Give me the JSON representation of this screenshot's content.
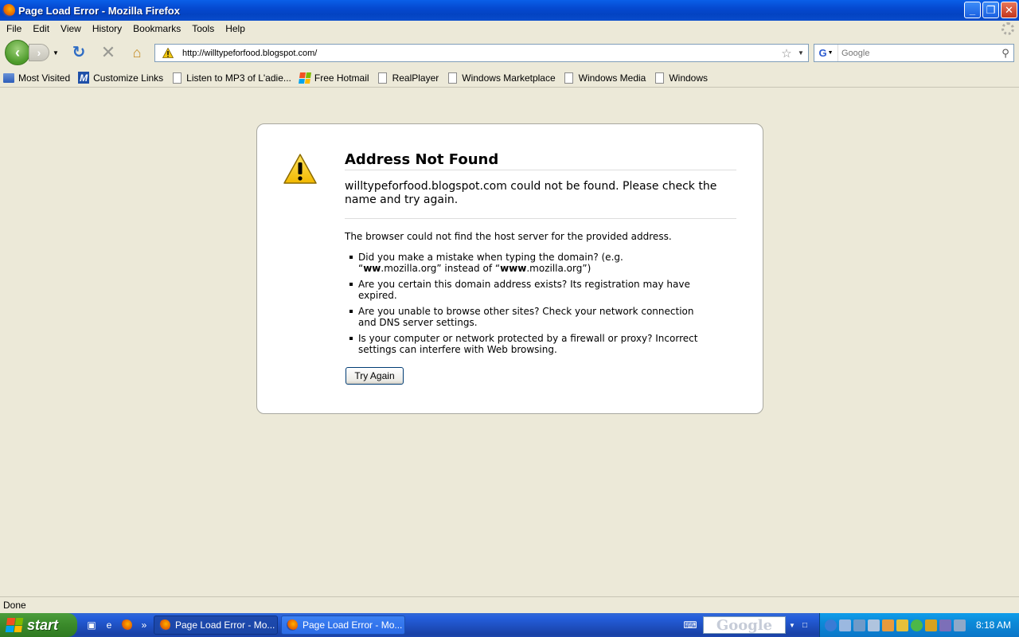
{
  "window": {
    "title": "Page Load Error - Mozilla Firefox",
    "controls": {
      "minimize": "_",
      "restore": "❐",
      "close": "✕"
    }
  },
  "menu": [
    "File",
    "Edit",
    "View",
    "History",
    "Bookmarks",
    "Tools",
    "Help"
  ],
  "nav": {
    "url": "http://willtypeforfood.blogspot.com/",
    "search_placeholder": "Google"
  },
  "bookmarks": [
    {
      "label": "Most Visited",
      "icon": "most-visited-icon"
    },
    {
      "label": "Customize Links",
      "icon": "m-icon"
    },
    {
      "label": "Listen to MP3 of L'adie...",
      "icon": "page-icon"
    },
    {
      "label": "Free Hotmail",
      "icon": "windows-icon"
    },
    {
      "label": "RealPlayer",
      "icon": "page-icon"
    },
    {
      "label": "Windows Marketplace",
      "icon": "page-icon"
    },
    {
      "label": "Windows Media",
      "icon": "page-icon"
    },
    {
      "label": "Windows",
      "icon": "page-icon"
    }
  ],
  "error": {
    "title": "Address Not Found",
    "short_desc": "willtypeforfood.blogspot.com could not be found. Please check the name and try again.",
    "long_intro": "The browser could not find the host server for the provided address.",
    "items": [
      {
        "pre": "Did you make a mistake when typing the domain? (e.g. “",
        "b1": "ww",
        "mid": ".mozilla.org” instead of “",
        "b2": "www",
        "post": ".mozilla.org”)"
      },
      {
        "text": "Are you certain this domain address exists? Its registration may have expired."
      },
      {
        "text": "Are you unable to browse other sites? Check your network connection and DNS server settings."
      },
      {
        "text": "Is your computer or network protected by a firewall or proxy? Incorrect settings can interfere with Web browsing."
      }
    ],
    "try_again": "Try Again"
  },
  "status": "Done",
  "taskbar": {
    "start": "start",
    "tasks": [
      "Page Load Error - Mo...",
      "Page Load Error - Mo..."
    ],
    "google_box": "Google",
    "clock": "8:18 AM"
  },
  "colors": {
    "titlebar": "#0549D0",
    "chrome": "#ECE9D8",
    "taskbar": "#245EDB",
    "start": "#3A8A2A"
  }
}
